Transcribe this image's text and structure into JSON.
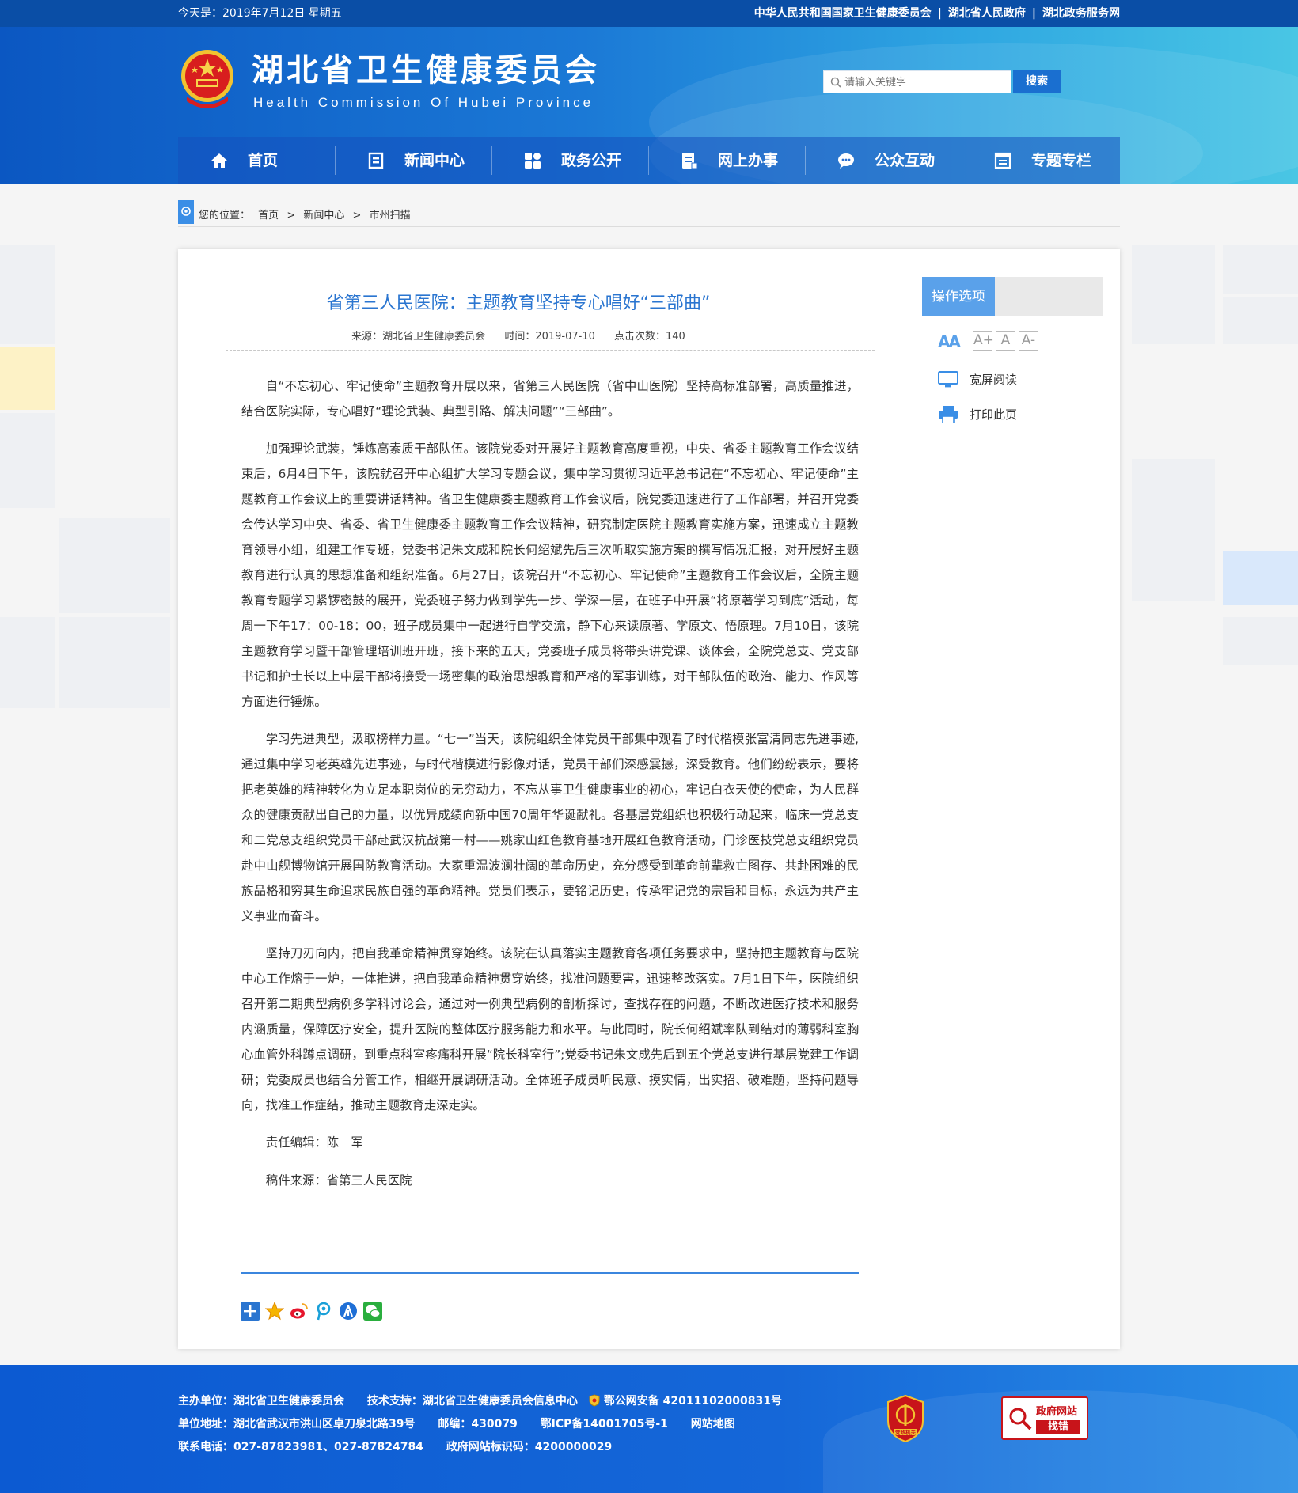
{
  "topbar": {
    "date": "今天是：2019年7月12日 星期五",
    "links": [
      "中华人民共和国国家卫生健康委员会",
      "湖北省人民政府",
      "湖北政务服务网"
    ]
  },
  "header": {
    "title": "湖北省卫生健康委员会",
    "subtitle": "Health Commission Of Hubei Province",
    "search_placeholder": "请输入关键字",
    "search_button": "搜索"
  },
  "nav": [
    {
      "label": "首页",
      "icon": "home-icon"
    },
    {
      "label": "新闻中心",
      "icon": "news-icon"
    },
    {
      "label": "政务公开",
      "icon": "grid-icon"
    },
    {
      "label": "网上办事",
      "icon": "form-icon"
    },
    {
      "label": "公众互动",
      "icon": "chat-icon"
    },
    {
      "label": "专题专栏",
      "icon": "column-icon"
    }
  ],
  "breadcrumb": {
    "prefix": "您的位置：",
    "items": [
      "首页",
      "新闻中心",
      "市州扫描"
    ],
    "separator": ">"
  },
  "article": {
    "title": "省第三人民医院：主题教育坚持专心唱好“三部曲”",
    "source": "来源：湖北省卫生健康委员会",
    "time": "时间：2019-07-10",
    "clicks": "点击次数：140",
    "paragraphs": [
      "自“不忘初心、牢记使命”主题教育开展以来，省第三人民医院（省中山医院）坚持高标准部署，高质量推进，结合医院实际，专心唱好“理论武装、典型引路、解决问题”“三部曲”。",
      "加强理论武装，锤炼高素质干部队伍。该院党委对开展好主题教育高度重视，中央、省委主题教育工作会议结束后，6月4日下午，该院就召开中心组扩大学习专题会议，集中学习贯彻习近平总书记在“不忘初心、牢记使命”主题教育工作会议上的重要讲话精神。省卫生健康委主题教育工作会议后，院党委迅速进行了工作部署，并召开党委会传达学习中央、省委、省卫生健康委主题教育工作会议精神，研究制定医院主题教育实施方案，迅速成立主题教育领导小组，组建工作专班，党委书记朱文成和院长何绍斌先后三次听取实施方案的撰写情况汇报，对开展好主题教育进行认真的思想准备和组织准备。6月27日，该院召开“不忘初心、牢记使命”主题教育工作会议后，全院主题教育专题学习紧锣密鼓的展开，党委班子努力做到学先一步、学深一层，在班子中开展“将原著学习到底”活动，每周一下午17：00-18：00，班子成员集中一起进行自学交流，静下心来读原著、学原文、悟原理。7月10日，该院主题教育学习暨干部管理培训班开班，接下来的五天，党委班子成员将带头讲党课、谈体会，全院党总支、党支部书记和护士长以上中层干部将接受一场密集的政治思想教育和严格的军事训练，对干部队伍的政治、能力、作风等方面进行锤炼。",
      "学习先进典型，汲取榜样力量。“七一”当天，该院组织全体党员干部集中观看了时代楷模张富清同志先进事迹,通过集中学习老英雄先进事迹，与时代楷模进行影像对话，党员干部们深感震撼，深受教育。他们纷纷表示，要将把老英雄的精神转化为立足本职岗位的无穷动力，不忘从事卫生健康事业的初心，牢记白衣天使的使命，为人民群众的健康贡献出自己的力量，以优异成绩向新中国70周年华诞献礼。各基层党组织也积极行动起来，临床一党总支和二党总支组织党员干部赴武汉抗战第一村——姚家山红色教育基地开展红色教育活动，门诊医技党总支组织党员赴中山舰博物馆开展国防教育活动。大家重温波澜壮阔的革命历史，充分感受到革命前辈救亡图存、共赴困难的民族品格和穷其生命追求民族自强的革命精神。党员们表示，要铭记历史，传承牢记党的宗旨和目标，永远为共产主义事业而奋斗。",
      "坚持刀刃向内，把自我革命精神贯穿始终。该院在认真落实主题教育各项任务要求中，坚持把主题教育与医院中心工作熔于一炉，一体推进，把自我革命精神贯穿始终，找准问题要害，迅速整改落实。7月1日下午，医院组织召开第二期典型病例多学科讨论会，通过对一例典型病例的剖析探讨，查找存在的问题，不断改进医疗技术和服务内涵质量，保障医疗安全，提升医院的整体医疗服务能力和水平。与此同时，院长何绍斌率队到结对的薄弱科室胸心血管外科蹲点调研，到重点科室疼痛科开展“院长科室行”;党委书记朱文成先后到五个党总支进行基层党建工作调研；党委成员也结合分管工作，相继开展调研活动。全体班子成员听民意、摸实情，出实招、破难题，坚持问题导向，找准工作症结，推动主题教育走深走实。"
    ],
    "editor": "责任编辑：陈　军",
    "manuscript_source": "稿件来源：省第三人民医院"
  },
  "options": {
    "title": "操作选项",
    "font_label": "AA",
    "font_buttons": [
      "A+",
      "A",
      "A-"
    ],
    "wide_read": "宽屏阅读",
    "print": "打印此页"
  },
  "share_icons": [
    "share-more-icon",
    "favorite-icon",
    "weibo-icon",
    "tencent-icon",
    "renren-icon",
    "wechat-icon"
  ],
  "footer": {
    "line1": {
      "host": "主办单位：湖北省卫生健康委员会",
      "tech": "技术支持：湖北省卫生健康委员会信息中心",
      "police": "鄂公网安备 42011102000831号"
    },
    "line2": {
      "address": "单位地址：湖北省武汉市洪山区卓刀泉北路39号",
      "postcode": "邮编：430079",
      "icp": "鄂ICP备14001705号-1",
      "sitemap": "网站地图"
    },
    "line3": {
      "phone": "联系电话：027-87823981、027-87824784",
      "gov_code": "政府网站标识码：4200000029"
    },
    "party_badge": "党政机关",
    "gov_find_line1": "政府网站",
    "gov_find_line2": "找错"
  },
  "colors": {
    "accent": "#2a75d0",
    "header_dark": "#0a4ea6",
    "option_tab": "#5aa1ea",
    "error_red": "#c8141a"
  }
}
